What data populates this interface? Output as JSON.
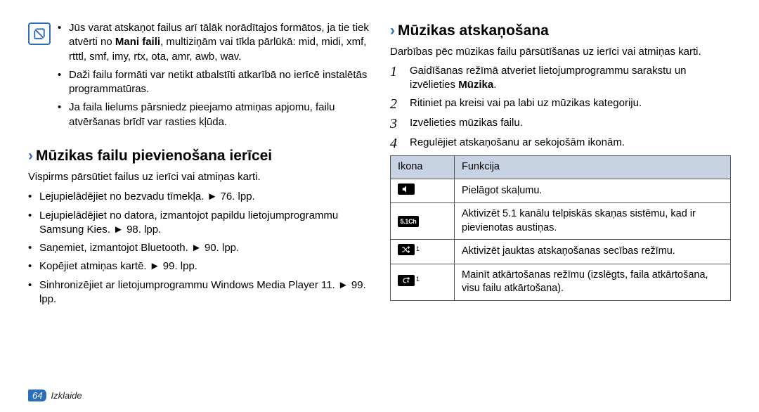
{
  "left": {
    "note_bullets": [
      {
        "pre": "Jūs varat atskaņot failus arī tālāk norādītajos formātos, ja tie tiek atvērti no ",
        "bold": "Mani faili",
        "post": ", multiziņām vai tīkla pārlūkā: mid, midi, xmf, rtttl, smf, imy, rtx, ota, amr, awb, wav."
      },
      {
        "text": "Daži failu formāti var netikt atbalstīti atkarībā no ierīcē instalētās programmatūras."
      },
      {
        "text": "Ja faila lielums pārsniedz pieejamo atmiņas apjomu, failu atvēršanas brīdī var rasties kļūda."
      }
    ],
    "section_title": "Mūzikas failu pievienošana ierīcei",
    "section_intro": "Vispirms pārsūtiet failus uz ierīci vai atmiņas karti.",
    "add_bullets": [
      "Lejupielādējiet no bezvadu tīmekļa. ► 76. lpp.",
      "Lejupielādējiet no datora, izmantojot papildu lietojumprogrammu Samsung Kies. ► 98. lpp.",
      "Saņemiet, izmantojot Bluetooth. ► 90. lpp.",
      "Kopējiet atmiņas kartē. ► 99. lpp.",
      "Sinhronizējiet ar lietojumprogrammu Windows Media Player 11. ► 99. lpp."
    ]
  },
  "right": {
    "section_title": "Mūzikas atskaņošana",
    "section_intro": "Darbības pēc mūzikas failu pārsūtīšanas uz ierīci vai atmiņas karti.",
    "steps": [
      {
        "n": "1",
        "pre": "Gaidīšanas režīmā atveriet lietojumprogrammu sarakstu un izvēlieties ",
        "bold": "Mūzika",
        "post": "."
      },
      {
        "n": "2",
        "text": "Ritiniet pa kreisi vai pa labi uz mūzikas kategoriju."
      },
      {
        "n": "3",
        "text": "Izvēlieties mūzikas failu."
      },
      {
        "n": "4",
        "text": "Regulējiet atskaņošanu ar sekojošām ikonām."
      }
    ],
    "table": {
      "h1": "Ikona",
      "h2": "Funkcija",
      "rows": [
        {
          "icon": "speaker",
          "sup": "",
          "text": "Pielāgot skaļumu."
        },
        {
          "icon": "fiveone",
          "sup": "",
          "text": "Aktivizēt 5.1 kanālu telpiskās skaņas sistēmu, kad ir pievienotas austiņas."
        },
        {
          "icon": "shuffle",
          "sup": "1",
          "text": "Aktivizēt jauktas atskaņošanas secības režīmu."
        },
        {
          "icon": "repeat",
          "sup": "1",
          "text": "Mainīt atkārtošanas režīmu (izslēgts, faila atkārtošana, visu failu atkārtošana)."
        }
      ]
    }
  },
  "footer": {
    "page": "64",
    "section": "Izklaide"
  }
}
